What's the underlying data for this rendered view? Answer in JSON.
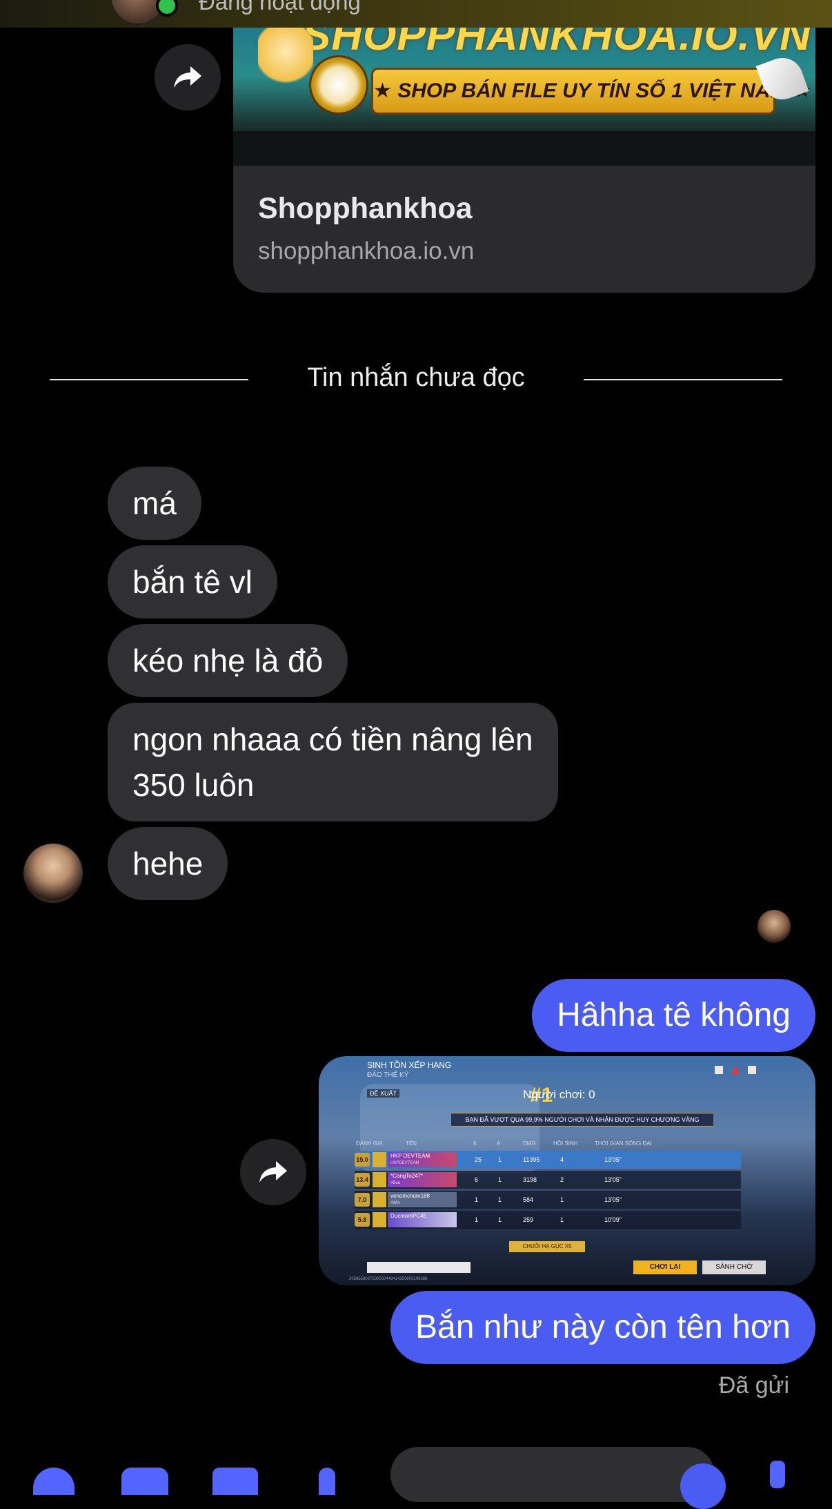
{
  "header": {
    "status_text": "Đang hoạt động"
  },
  "link_preview": {
    "banner_title": "SHOPPHANKHOA.IO.VN",
    "banner_slogan": "★ SHOP BÁN FILE UY TÍN SỐ 1 VIỆT NAM ★",
    "title": "Shopphankhoa",
    "url": "shopphankhoa.io.vn"
  },
  "divider": {
    "label": "Tin nhắn chưa đọc"
  },
  "incoming_messages": [
    {
      "text": "má"
    },
    {
      "text": "bắn tê vl"
    },
    {
      "text": "kéo nhẹ là đỏ"
    },
    {
      "text": "ngon nhaaa có tiền nâng lên\n350 luôn"
    },
    {
      "text": "hehe"
    }
  ],
  "outgoing_messages": [
    {
      "text": "Hâhha tê không"
    },
    {
      "text": "Bắn như này còn tên hơn"
    }
  ],
  "sent_status": "Đã gửi",
  "game_screenshot": {
    "mode_title": "SINH TỒN XẾP HẠNG",
    "mode_sub": "ĐẢO THẾ KỶ",
    "propose": "ĐỀ XUẤT",
    "rank": "#1",
    "players_label": "Người chơi: 0",
    "banner": "BẠN ĐÃ VƯỢT QUA 99,9% NGƯỜI CHƠI VÀ NHẬN ĐƯỢC HUY CHƯƠNG VÀNG",
    "columns": [
      "ĐÁNH GIÁ",
      "TÊN",
      "K",
      "A",
      "DMG",
      "HỒI SINH",
      "THỜI GIAN SỐNG ĐẠI"
    ],
    "rows": [
      {
        "score": "15.0",
        "name": "HKP DEVTEAM",
        "tag": "HKPDEVTEAM",
        "k": "25",
        "a": "1",
        "dmg": "11395",
        "revive": "4",
        "time": "13'05\"",
        "me": true
      },
      {
        "score": "13.4",
        "name": "*CongTo247*",
        "tag": "#Bua",
        "k": "6",
        "a": "1",
        "dmg": "3198",
        "revive": "2",
        "time": "13'05\"",
        "me": false
      },
      {
        "score": "7.0",
        "name": "venomchúm188",
        "tag": "#Win",
        "k": "1",
        "a": "1",
        "dmg": "584",
        "revive": "1",
        "time": "13'05\"",
        "me": false
      },
      {
        "score": "5.8",
        "name": "DucmomPC45",
        "tag": "",
        "k": "1",
        "a": "1",
        "dmg": "259",
        "revive": "1",
        "time": "10'09\"",
        "me": false
      }
    ],
    "streak": "CHUỖI HẠ GỤC X5",
    "play_again": "CHƠI LẠI",
    "lobby": "SẢNH CHỜ",
    "footer_id": "2058558007530000448414350603198388"
  },
  "icons": {
    "forward": "forward-arrow-icon",
    "composer": [
      "plus-icon",
      "camera-icon",
      "gallery-icon",
      "mic-icon",
      "emoji-icon",
      "like-icon"
    ]
  },
  "colors": {
    "background": "#000000",
    "incoming_bubble": "#303032",
    "outgoing_bubble": "#4b5cf3",
    "divider_line": "#e7e7e7",
    "secondary_text": "#a8a8a8"
  }
}
